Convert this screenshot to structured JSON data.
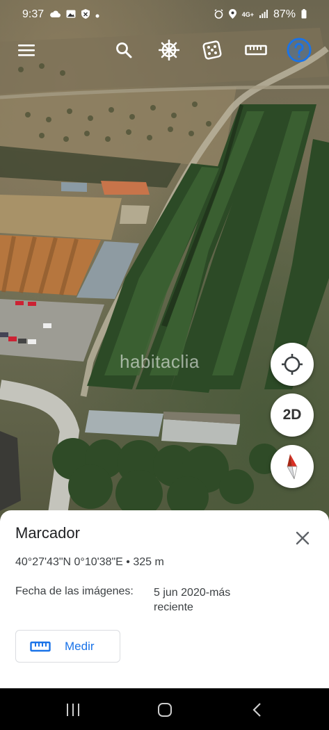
{
  "status_bar": {
    "time": "9:37",
    "battery": "87%",
    "network": "4G+",
    "icons": [
      "cloud-icon",
      "image-icon",
      "shield-icon",
      "dot-icon",
      "alarm-icon",
      "location-icon",
      "signal-icon",
      "battery-icon"
    ]
  },
  "toolbar": {
    "buttons": [
      "menu-icon",
      "search-icon",
      "voyager-icon",
      "dice-icon",
      "ruler-icon",
      "help-icon"
    ]
  },
  "map": {
    "watermark": "habitaclia",
    "buttons": {
      "locate": "locate-icon",
      "view_mode": "2D",
      "compass": "compass-icon"
    }
  },
  "panel": {
    "title": "Marcador",
    "coordinates": "40°27'43\"N 0°10'38\"E • 325 m",
    "date_label": "Fecha de las imágenes:",
    "date_value": "5 jun 2020-más reciente",
    "measure_label": "Medir"
  },
  "colors": {
    "accent": "#1a73e8",
    "help": "#1a73e8",
    "compass_red": "#d93025"
  }
}
